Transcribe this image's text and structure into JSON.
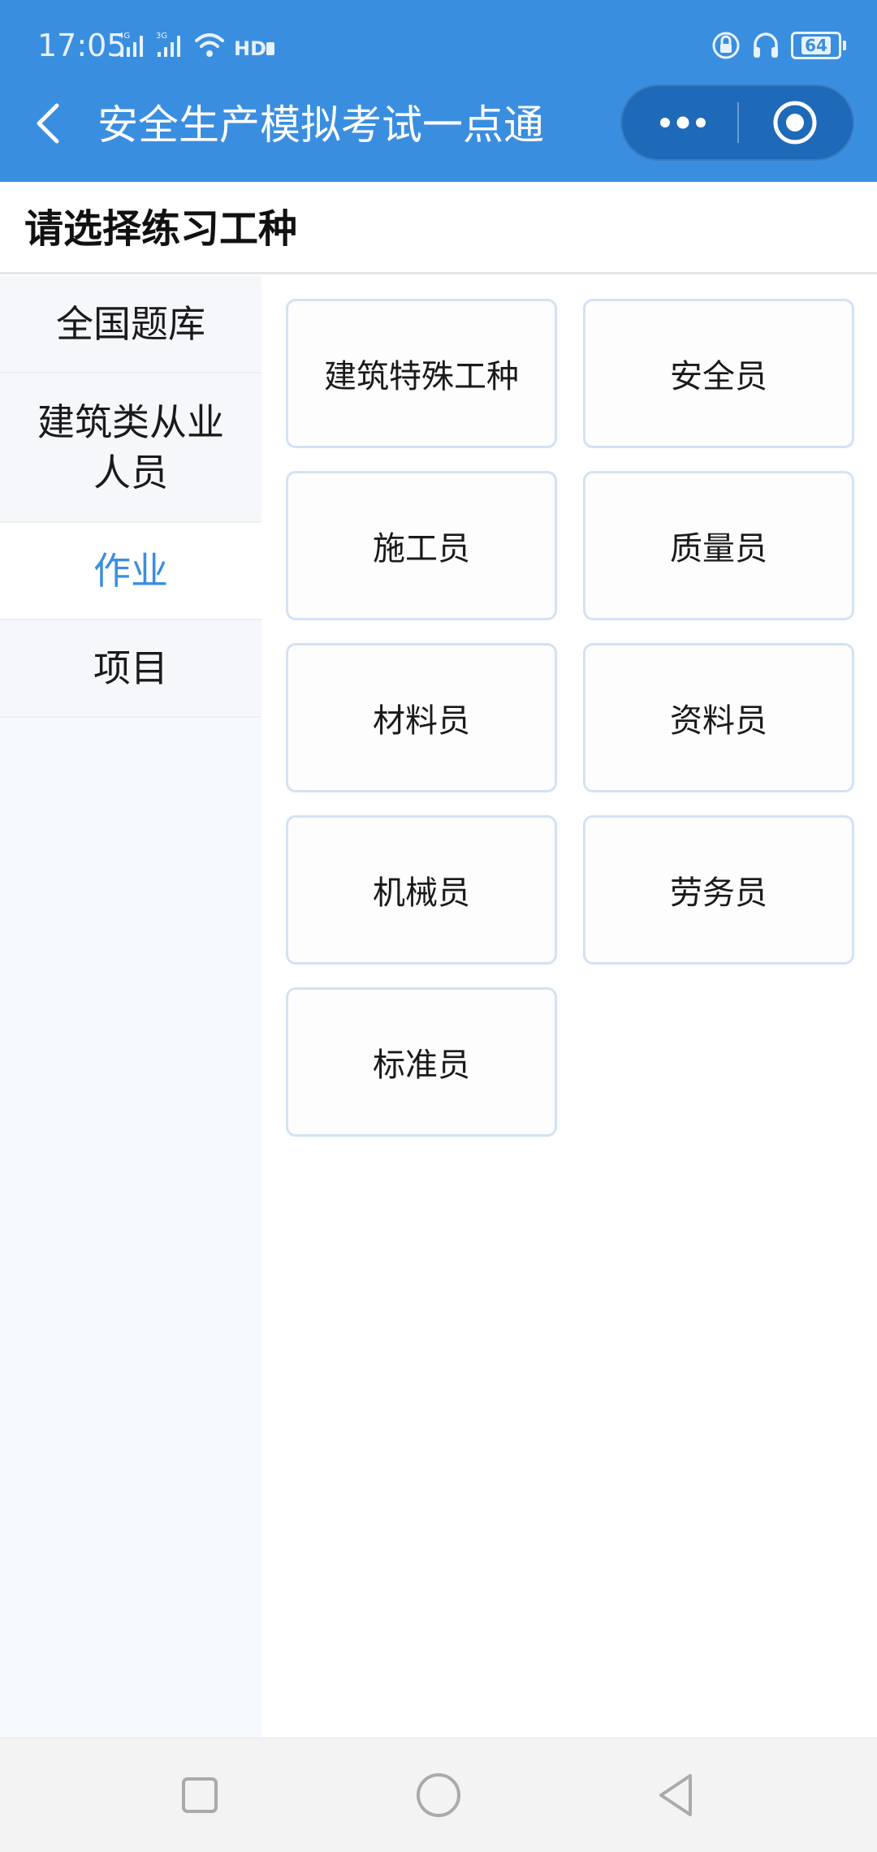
{
  "status_bar": {
    "time": "17:05",
    "signal_1_label": "4G",
    "signal_2_label": "3G",
    "hd_label": "HD",
    "battery_level": "64"
  },
  "nav": {
    "title": "安全生产模拟考试一点通"
  },
  "page": {
    "title": "请选择练习工种"
  },
  "sidebar": {
    "items": [
      {
        "label": "全国题库",
        "active": false
      },
      {
        "label": "建筑类从业人员",
        "active": false
      },
      {
        "label": "作业",
        "active": true
      },
      {
        "label": "项目",
        "active": false
      }
    ]
  },
  "grid": {
    "items": [
      "建筑特殊工种",
      "安全员",
      "施工员",
      "质量员",
      "材料员",
      "资料员",
      "机械员",
      "劳务员",
      "标准员"
    ]
  },
  "colors": {
    "header_bg": "#3a8ee0",
    "capsule_bg": "#1f6ab8",
    "active_text": "#3a8ee0",
    "card_border": "#d3e2f4"
  },
  "icons": [
    "back-icon",
    "more-icon",
    "target-icon",
    "signal-icon",
    "wifi-icon",
    "lock-icon",
    "headphone-icon",
    "battery-icon",
    "square-nav-icon",
    "circle-nav-icon",
    "triangle-nav-icon"
  ]
}
